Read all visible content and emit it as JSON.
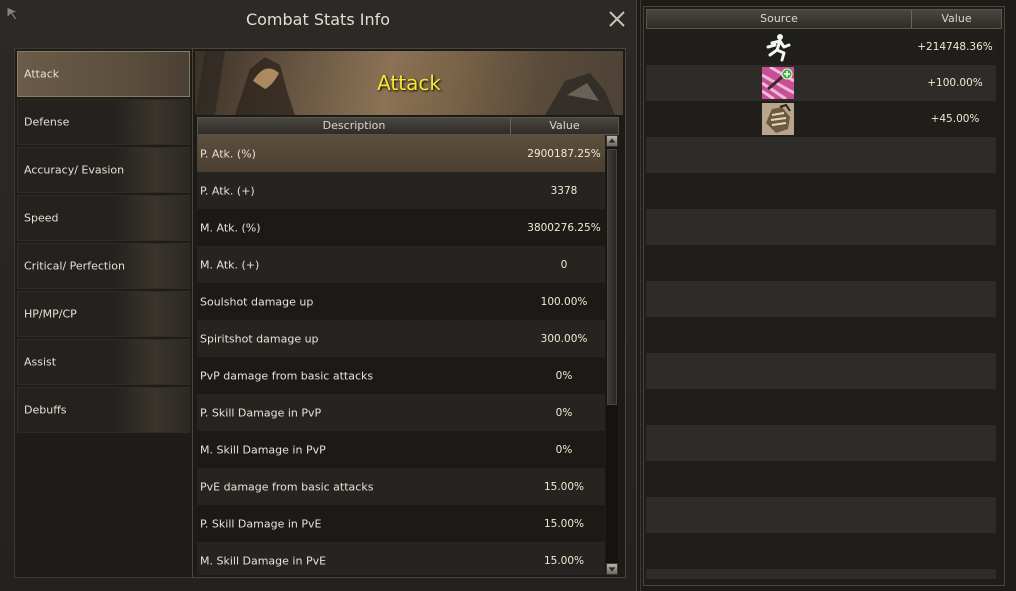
{
  "window": {
    "title": "Combat Stats Info"
  },
  "sidebar": {
    "items": [
      {
        "label": "Attack",
        "active": true
      },
      {
        "label": "Defense"
      },
      {
        "label": "Accuracy/ Evasion"
      },
      {
        "label": "Speed"
      },
      {
        "label": "Critical/ Perfection"
      },
      {
        "label": "HP/MP/CP"
      },
      {
        "label": "Assist"
      },
      {
        "label": "Debuffs"
      }
    ]
  },
  "main": {
    "banner_title": "Attack",
    "columns": {
      "description": "Description",
      "value": "Value"
    },
    "rows": [
      {
        "description": "P. Atk. (%)",
        "value": "2900187.25%",
        "selected": true
      },
      {
        "description": "P. Atk. (+)",
        "value": "3378"
      },
      {
        "description": "M. Atk. (%)",
        "value": "3800276.25%"
      },
      {
        "description": "M. Atk. (+)",
        "value": "0"
      },
      {
        "description": "Soulshot damage up",
        "value": "100.00%"
      },
      {
        "description": "Spiritshot damage up",
        "value": "300.00%"
      },
      {
        "description": "PvP damage from basic attacks",
        "value": "0%"
      },
      {
        "description": "P. Skill Damage in PvP",
        "value": "0%"
      },
      {
        "description": "M. Skill Damage in PvP",
        "value": "0%"
      },
      {
        "description": "PvE damage from basic attacks",
        "value": "15.00%"
      },
      {
        "description": "P. Skill Damage in PvE",
        "value": "15.00%"
      },
      {
        "description": "M. Skill Damage in PvE",
        "value": "15.00%"
      }
    ]
  },
  "source_panel": {
    "columns": {
      "source": "Source",
      "value": "Value"
    },
    "rows": [
      {
        "icon": "running-figure-icon",
        "value": "+214748.36%"
      },
      {
        "icon": "pink-buff-icon",
        "value": "+100.00%"
      },
      {
        "icon": "fist-gauntlet-icon",
        "value": "+45.00%"
      }
    ]
  },
  "colors": {
    "banner_title": "#f5e830",
    "selected_row": "#5d4f3d"
  }
}
